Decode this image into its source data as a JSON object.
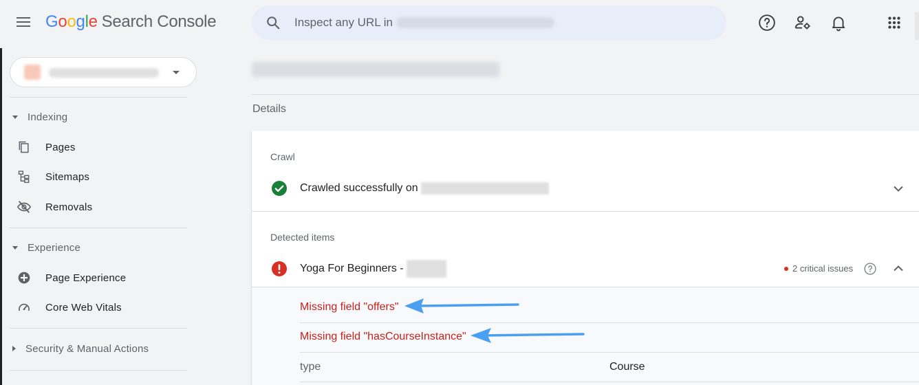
{
  "app": {
    "title": "Search Console",
    "logo": [
      "G",
      "o",
      "o",
      "g",
      "l",
      "e"
    ]
  },
  "search": {
    "placeholder": "Inspect any URL in"
  },
  "header_icons": [
    "help-icon",
    "manage-users-icon",
    "notifications-icon",
    "apps-grid-icon"
  ],
  "sidebar": {
    "sections": [
      {
        "label": "Indexing",
        "expanded": true,
        "items": [
          {
            "label": "Pages",
            "icon": "pages-icon"
          },
          {
            "label": "Sitemaps",
            "icon": "sitemaps-icon"
          },
          {
            "label": "Removals",
            "icon": "removals-icon"
          }
        ]
      },
      {
        "label": "Experience",
        "expanded": true,
        "items": [
          {
            "label": "Page Experience",
            "icon": "page-experience-icon"
          },
          {
            "label": "Core Web Vitals",
            "icon": "core-web-vitals-icon"
          }
        ]
      },
      {
        "label": "Security & Manual Actions",
        "expanded": false,
        "items": []
      }
    ]
  },
  "main": {
    "details_label": "Details",
    "crawl": {
      "section_label": "Crawl",
      "status_text": "Crawled successfully on"
    },
    "detected": {
      "section_label": "Detected items",
      "item_title": "Yoga For Beginners -",
      "issues_text": "2 critical issues",
      "issues": [
        "Missing field \"offers\"",
        "Missing field \"hasCourseInstance\""
      ],
      "properties": [
        {
          "key": "type",
          "value": "Course"
        }
      ]
    }
  },
  "colors": {
    "error": "#d93025",
    "success": "#188038",
    "annotation_arrow": "#4a9ff0"
  }
}
